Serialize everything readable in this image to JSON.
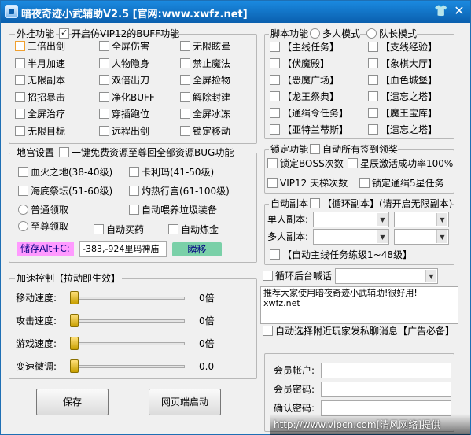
{
  "window": {
    "title": "暗夜奇迹小武辅助V2.5  [官网:www.xwfz.net]"
  },
  "plugin": {
    "group_label": "外挂功能",
    "vip_label": "开启仿VIP12的BUFF功能",
    "options": [
      "三倍出剑",
      "全屏伤害",
      "无限眩晕",
      "半月加速",
      "人物隐身",
      "禁止魔法",
      "无限副本",
      "双倍出刀",
      "全屏捡物",
      "招招暴击",
      "净化BUFF",
      "解除封建",
      "全屏治疗",
      "穿插跑位",
      "全屏冰冻",
      "无限目标",
      "远程出剑",
      "锁定移动"
    ]
  },
  "palace": {
    "group_label": "地宫设置",
    "oneclick_label": "一键免费资源至尊回全部资源BUG功能",
    "opt1": "血火之地(38-40级)",
    "opt2": "卡利玛(41-50级)",
    "opt3": "海底祭坛(51-60级)",
    "opt4": "灼热行宫(61-100级)",
    "radio1": "普通领取",
    "radio2": "至尊领取",
    "auto_feed": "自动喂养垃圾装备",
    "auto_buy": "自动买药",
    "auto_refine": "自动炼金",
    "store_label": "储存Alt+C:",
    "coords": "-383,-924里玛神庙",
    "teleport": "瞬移"
  },
  "speed": {
    "group_label": "加速控制【拉动即生效】",
    "rows": [
      {
        "label": "移动速度:",
        "value": "0倍",
        "level": 0
      },
      {
        "label": "攻击速度:",
        "value": "0倍",
        "level": 0
      },
      {
        "label": "游戏速度:",
        "value": "0倍",
        "level": 0
      },
      {
        "label": "变速微调:",
        "value": "0.0",
        "level": 0
      }
    ]
  },
  "buttons": {
    "save": "保存",
    "web_start": "网页端启动"
  },
  "script": {
    "group_label": "脚本功能",
    "mode_multi": "多人模式",
    "mode_captain": "队长模式",
    "tasks": [
      "【主线任务】",
      "【支线经验】",
      "【伏魔殿】",
      "【象棋大厅】",
      "【恶魔广场】",
      "【血色城堡】",
      "【龙王祭典】",
      "【遗忘之塔】",
      "【通缉令任务】",
      "【魔王宝库】",
      "【亚特兰蒂斯】",
      "【遗忘之塔】"
    ]
  },
  "lock": {
    "group_label": "锁定功能",
    "auto_signin": "自动所有签到领奖",
    "lock_boss": "锁定BOSS次数",
    "star_rate": "星辰激活成功率100%",
    "vip12": "VIP12 天梯次数",
    "lock_wanted": "锁定通缉5星任务"
  },
  "auto": {
    "group_label": "自动副本",
    "loop_label": "【循环副本】(请开启无限副本)",
    "single": "单人副本:",
    "multi": "多人副本:",
    "main_task": "【自动主线任务练级1~48级】"
  },
  "loop_talk": {
    "label": "循环后台喊话",
    "message": "推荐大家使用暗夜奇迹小武辅助!很好用!\nxwfz.net"
  },
  "auto_chat": "自动选择附近玩家发私聊消息【广告必备】",
  "account": {
    "user_label": "会员帐户:",
    "pwd_label": "会员密码:",
    "confirm_label": "确认密码:"
  },
  "watermark": "http://www.vipcn.com[清风网络]提供",
  "colors": {
    "title_bar": "#0a5fae",
    "store_bg": "#ff9aff",
    "teleport_bg": "#7ad0a8"
  }
}
